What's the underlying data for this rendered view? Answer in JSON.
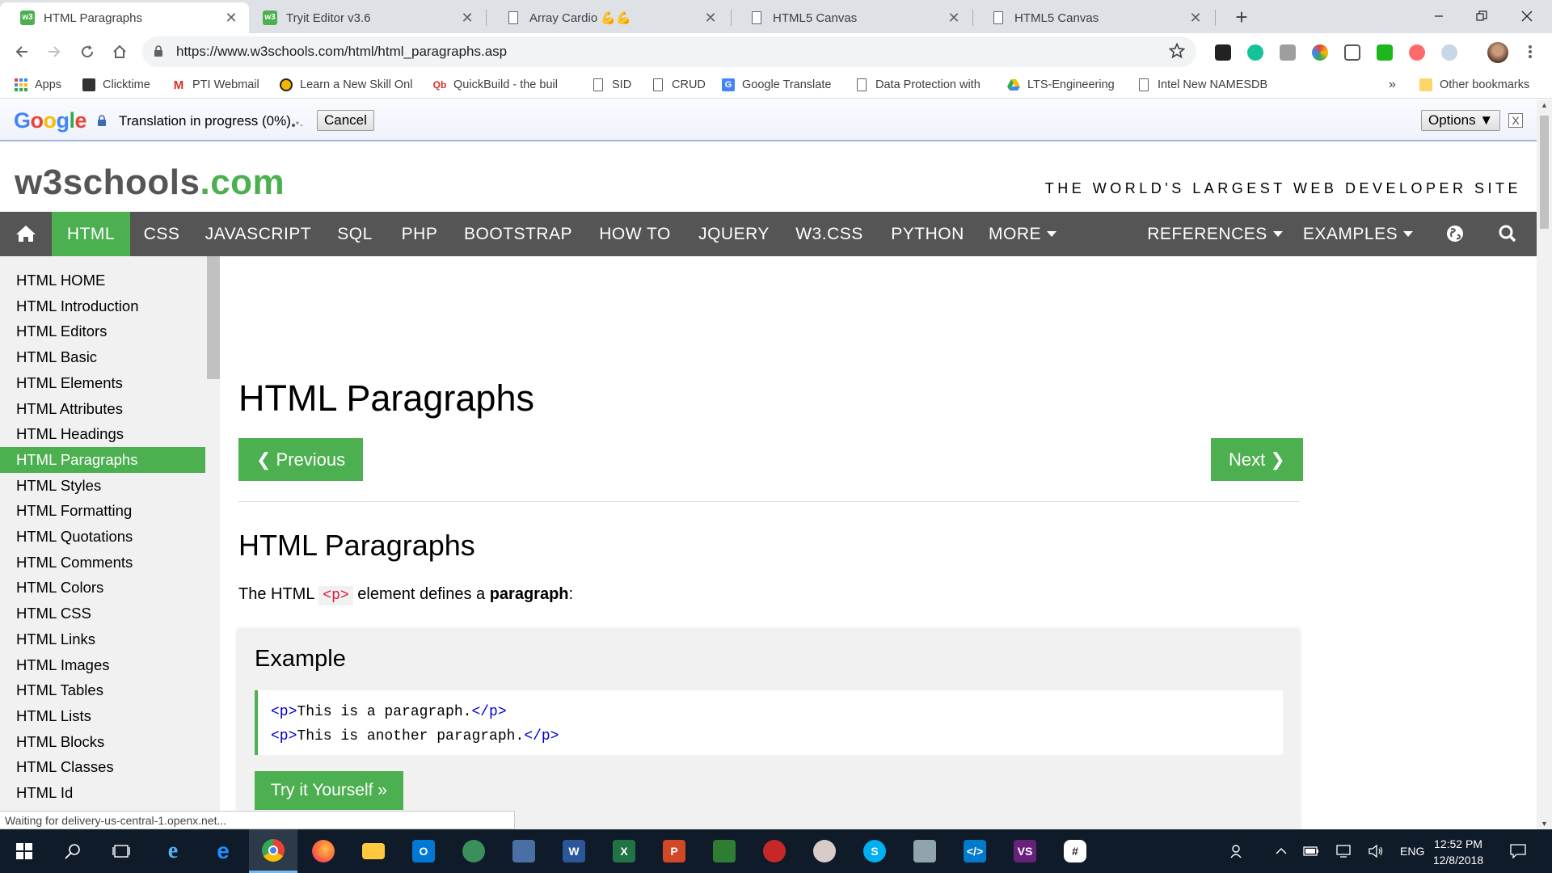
{
  "browser": {
    "tabs": [
      {
        "title": "HTML Paragraphs",
        "icon": "w3schools-favicon",
        "active": true
      },
      {
        "title": "Tryit Editor v3.6",
        "icon": "w3schools-favicon",
        "active": false
      },
      {
        "title": "Array Cardio 💪💪",
        "icon": "page-icon",
        "active": false
      },
      {
        "title": "HTML5 Canvas",
        "icon": "page-icon",
        "active": false
      },
      {
        "title": "HTML5 Canvas",
        "icon": "page-icon",
        "active": false
      }
    ],
    "url": "https://www.w3schools.com/html/html_paragraphs.asp",
    "bookmarks": [
      {
        "label": "Apps",
        "icon": "apps-grid-icon"
      },
      {
        "label": "Clicktime",
        "icon": "clicktime-icon"
      },
      {
        "label": "PTI Webmail",
        "icon": "gmail-icon"
      },
      {
        "label": "Learn a New Skill Onl",
        "icon": "lynda-icon"
      },
      {
        "label": "QuickBuild - the buil",
        "icon": "quickbuild-icon"
      },
      {
        "label": "SID",
        "icon": "page-icon"
      },
      {
        "label": "CRUD",
        "icon": "page-icon"
      },
      {
        "label": "Google Translate",
        "icon": "translate-icon"
      },
      {
        "label": "Data Protection with",
        "icon": "page-icon"
      },
      {
        "label": "LTS-Engineering",
        "icon": "drive-icon"
      },
      {
        "label": "Intel New NAMESDB",
        "icon": "page-icon"
      }
    ],
    "bookmarks_overflow": "»",
    "other_bookmarks": "Other bookmarks"
  },
  "translate_bar": {
    "logo": "Google",
    "message": "Translation in progress (0%)",
    "cancel_label": "Cancel",
    "options_label": "Options ▼",
    "close_glyph": "X"
  },
  "site": {
    "logo_main": "w3schools",
    "logo_suffix": ".com",
    "tagline": "THE WORLD'S LARGEST WEB DEVELOPER SITE",
    "nav": [
      {
        "label": "HTML",
        "active": true
      },
      {
        "label": "CSS"
      },
      {
        "label": "JAVASCRIPT"
      },
      {
        "label": "SQL"
      },
      {
        "label": "PHP"
      },
      {
        "label": "BOOTSTRAP"
      },
      {
        "label": "HOW TO"
      },
      {
        "label": "JQUERY"
      },
      {
        "label": "W3.CSS"
      },
      {
        "label": "PYTHON"
      },
      {
        "label": "MORE"
      }
    ],
    "nav_right": [
      {
        "label": "REFERENCES"
      },
      {
        "label": "EXAMPLES"
      }
    ],
    "sidenav": [
      "HTML HOME",
      "HTML Introduction",
      "HTML Editors",
      "HTML Basic",
      "HTML Elements",
      "HTML Attributes",
      "HTML Headings",
      "HTML Paragraphs",
      "HTML Styles",
      "HTML Formatting",
      "HTML Quotations",
      "HTML Comments",
      "HTML Colors",
      "HTML CSS",
      "HTML Links",
      "HTML Images",
      "HTML Tables",
      "HTML Lists",
      "HTML Blocks",
      "HTML Classes",
      "HTML Id"
    ],
    "sidenav_active_index": 7,
    "accent_color": "#4CAF50",
    "nav_bg_color": "#555555"
  },
  "content": {
    "page_title": "HTML Paragraphs",
    "prev_label": "❮ Previous",
    "next_label": "Next ❯",
    "section_title": "HTML Paragraphs",
    "intro_before": "The HTML",
    "intro_code": "<p>",
    "intro_mid": "element defines a",
    "intro_bold": "paragraph",
    "intro_after": ":",
    "example_title": "Example",
    "code_lines": [
      {
        "open": "<p>",
        "text": "This is a paragraph.",
        "close": "</p>"
      },
      {
        "open": "<p>",
        "text": "This is another paragraph.",
        "close": "</p>"
      }
    ],
    "try_label": "Try it Yourself »"
  },
  "status_text": "Waiting for delivery-us-central-1.openx.net...",
  "taskbar": {
    "language": "ENG",
    "time": "12:52 PM",
    "date": "12/8/2018"
  }
}
